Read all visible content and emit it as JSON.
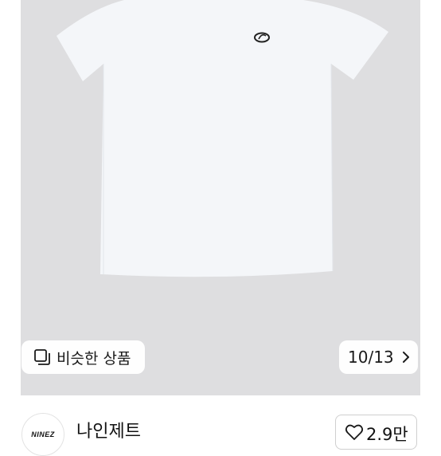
{
  "similar": {
    "label": "비슷한 상품",
    "icon": "similar-items-icon"
  },
  "gallery": {
    "counter": "10/13",
    "next_icon": "chevron-right-icon"
  },
  "shop": {
    "name": "나인제트",
    "logo_text": "NINEZ"
  },
  "like": {
    "count": "2.9만",
    "icon": "heart-outline-icon"
  },
  "colors": {
    "photo_bg": "#dedee0",
    "shirt": "#f3f5f8",
    "text": "#1a1a1a",
    "border": "#cfcfcf"
  }
}
